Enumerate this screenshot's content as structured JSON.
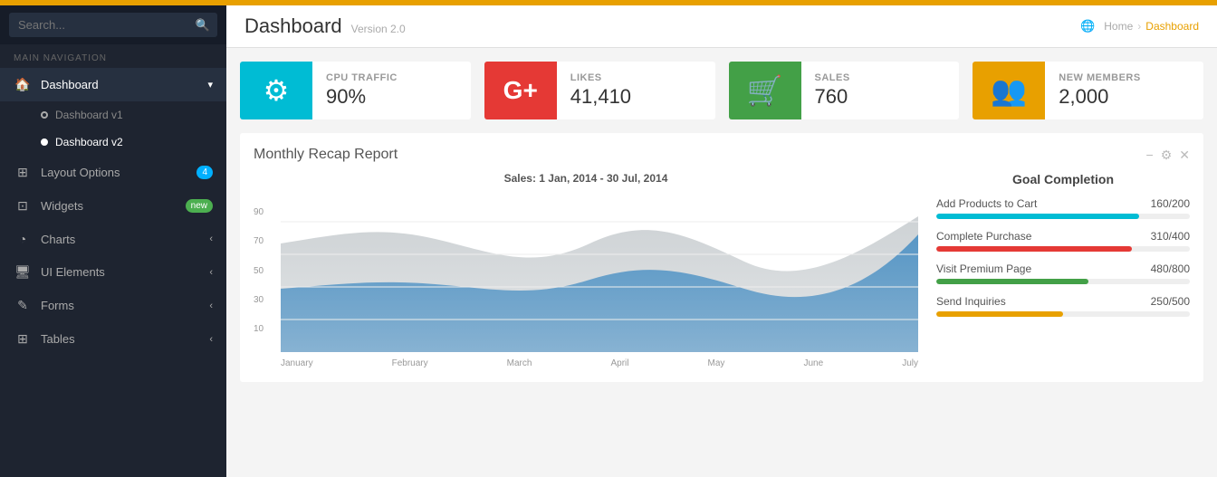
{
  "topbar": {},
  "sidebar": {
    "search_placeholder": "Search...",
    "nav_label": "MAIN NAVIGATION",
    "items": [
      {
        "id": "dashboard",
        "label": "Dashboard",
        "icon": "🏠",
        "has_arrow": true,
        "active": true
      },
      {
        "id": "dashboard-v1",
        "label": "Dashboard v1",
        "icon": "○",
        "sub": true,
        "active": false
      },
      {
        "id": "dashboard-v2",
        "label": "Dashboard v2",
        "icon": "●",
        "sub": true,
        "active": true
      },
      {
        "id": "layout-options",
        "label": "Layout Options",
        "icon": "⊞",
        "badge": "4",
        "badge_type": "blue"
      },
      {
        "id": "widgets",
        "label": "Widgets",
        "icon": "⊡",
        "badge": "new",
        "badge_type": "new"
      },
      {
        "id": "charts",
        "label": "Charts",
        "icon": "◔",
        "has_arrow": true
      },
      {
        "id": "ui-elements",
        "label": "UI Elements",
        "icon": "🖥",
        "has_arrow": true
      },
      {
        "id": "forms",
        "label": "Forms",
        "icon": "✎",
        "has_arrow": true
      },
      {
        "id": "tables",
        "label": "Tables",
        "icon": "⊞",
        "has_arrow": true
      }
    ]
  },
  "header": {
    "title": "Dashboard",
    "version": "Version 2.0",
    "breadcrumb": [
      "Home",
      "Dashboard"
    ]
  },
  "stat_cards": [
    {
      "id": "cpu",
      "label": "CPU TRAFFIC",
      "value": "90%",
      "color": "cyan",
      "icon": "⚙"
    },
    {
      "id": "likes",
      "label": "LIKES",
      "value": "41,410",
      "color": "red",
      "icon": "G+"
    },
    {
      "id": "sales",
      "label": "SALES",
      "value": "760",
      "color": "green",
      "icon": "🛒"
    },
    {
      "id": "members",
      "label": "NEW MEMBERS",
      "value": "2,000",
      "color": "orange",
      "icon": "👥"
    }
  ],
  "chart_section": {
    "title": "Monthly Recap Report",
    "subtitle": "Sales: 1 Jan, 2014 - 30 Jul, 2014",
    "y_labels": [
      "90",
      "70",
      "50",
      "30",
      "10"
    ],
    "x_labels": [
      "January",
      "February",
      "March",
      "April",
      "May",
      "June",
      "July"
    ],
    "actions": [
      "−",
      "🔧",
      "✕"
    ]
  },
  "goal_completion": {
    "title": "Goal Completion",
    "items": [
      {
        "label": "Add Products to Cart",
        "value": "160/200",
        "pct": 80,
        "color": "cyan"
      },
      {
        "label": "Complete Purchase",
        "value": "310/400",
        "pct": 77,
        "color": "red"
      },
      {
        "label": "Visit Premium Page",
        "value": "480/800",
        "pct": 60,
        "color": "green"
      },
      {
        "label": "Send Inquiries",
        "value": "250/500",
        "pct": 50,
        "color": "orange"
      }
    ]
  }
}
